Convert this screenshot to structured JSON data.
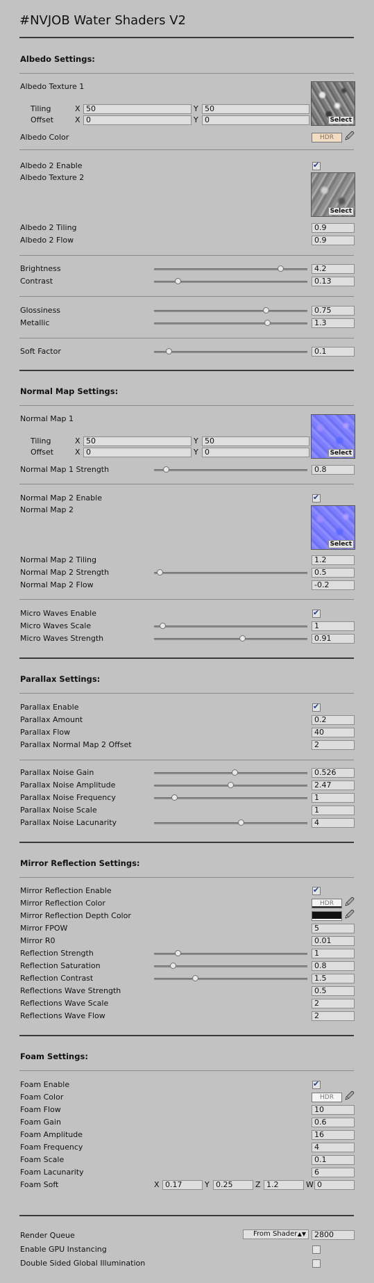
{
  "title": "#NVJOB Water Shaders V2",
  "tex_select": "Select",
  "hdr": "HDR",
  "albedo": {
    "header": "Albedo Settings:",
    "texture1": "Albedo Texture 1",
    "tiling": "Tiling",
    "offset": "Offset",
    "x": "X",
    "y": "Y",
    "tiling_x": "50",
    "tiling_y": "50",
    "offset_x": "0",
    "offset_y": "0",
    "color": "Albedo Color",
    "enable2": "Albedo 2 Enable",
    "texture2": "Albedo Texture 2",
    "tiling2": "Albedo 2 Tiling",
    "tiling2_val": "0.9",
    "flow2": "Albedo 2 Flow",
    "flow2_val": "0.9",
    "brightness": "Brightness",
    "brightness_val": "4.2",
    "contrast": "Contrast",
    "contrast_val": "0.13",
    "glossiness": "Glossiness",
    "glossiness_val": "0.75",
    "metallic": "Metallic",
    "metallic_val": "1.3",
    "soft": "Soft Factor",
    "soft_val": "0.1"
  },
  "normal": {
    "header": "Normal Map Settings:",
    "map1": "Normal Map 1",
    "tiling": "Tiling",
    "offset": "Offset",
    "x": "X",
    "y": "Y",
    "tiling_x": "50",
    "tiling_y": "50",
    "offset_x": "0",
    "offset_y": "0",
    "strength1": "Normal Map 1 Strength",
    "strength1_val": "0.8",
    "enable2": "Normal Map 2 Enable",
    "map2": "Normal Map 2",
    "tiling2": "Normal Map 2 Tiling",
    "tiling2_val": "1.2",
    "strength2": "Normal Map 2 Strength",
    "strength2_val": "0.5",
    "flow2": "Normal Map 2 Flow",
    "flow2_val": "-0.2",
    "micro_enable": "Micro Waves Enable",
    "micro_scale": "Micro Waves Scale",
    "micro_scale_val": "1",
    "micro_strength": "Micro Waves Strength",
    "micro_strength_val": "0.91"
  },
  "parallax": {
    "header": "Parallax Settings:",
    "enable": "Parallax Enable",
    "amount": "Parallax Amount",
    "amount_val": "0.2",
    "flow": "Parallax Flow",
    "flow_val": "40",
    "nm2off": "Parallax Normal Map 2 Offset",
    "nm2off_val": "2",
    "gain": "Parallax Noise Gain",
    "gain_val": "0.526",
    "amplitude": "Parallax Noise Amplitude",
    "amplitude_val": "2.47",
    "frequency": "Parallax Noise Frequency",
    "frequency_val": "1",
    "scale": "Parallax Noise Scale",
    "scale_val": "1",
    "lacunarity": "Parallax Noise Lacunarity",
    "lacunarity_val": "4"
  },
  "mirror": {
    "header": "Mirror Reflection Settings:",
    "enable": "Mirror Reflection Enable",
    "color": "Mirror Reflection Color",
    "depth_color": "Mirror Reflection Depth Color",
    "fpow": "Mirror FPOW",
    "fpow_val": "5",
    "r0": "Mirror R0",
    "r0_val": "0.01",
    "strength": "Reflection Strength",
    "strength_val": "1",
    "saturation": "Reflection Saturation",
    "saturation_val": "0.8",
    "contrast": "Reflection Contrast",
    "contrast_val": "1.5",
    "wave_strength": "Reflections Wave Strength",
    "wave_strength_val": "0.5",
    "wave_scale": "Reflections Wave Scale",
    "wave_scale_val": "2",
    "wave_flow": "Reflections Wave Flow",
    "wave_flow_val": "2"
  },
  "foam": {
    "header": "Foam Settings:",
    "enable": "Foam Enable",
    "color": "Foam Color",
    "flow": "Foam Flow",
    "flow_val": "10",
    "gain": "Foam Gain",
    "gain_val": "0.6",
    "amplitude": "Foam Amplitude",
    "amplitude_val": "16",
    "frequency": "Foam Frequency",
    "frequency_val": "4",
    "scale": "Foam Scale",
    "scale_val": "0.1",
    "lacunarity": "Foam Lacunarity",
    "lacunarity_val": "6",
    "soft": "Foam Soft",
    "soft_x": "0.17",
    "soft_y": "0.25",
    "soft_z": "1.2",
    "soft_w": "0",
    "x": "X",
    "y": "Y",
    "z": "Z",
    "w": "W"
  },
  "render": {
    "queue": "Render Queue",
    "queue_option": "From Shader",
    "queue_val": "2800",
    "gpu": "Enable GPU Instancing",
    "double_gi": "Double Sided Global Illumination"
  },
  "sliders": {
    "brightness": 0.84,
    "contrast": 0.14,
    "glossiness": 0.74,
    "metallic": 0.75,
    "soft": 0.08,
    "normal1": 0.06,
    "normal2": 0.02,
    "micro_scale": 0.04,
    "micro_strength": 0.58,
    "p_gain": 0.53,
    "p_amp": 0.5,
    "p_freq": 0.12,
    "p_lac": 0.57,
    "r_strength": 0.14,
    "r_saturation": 0.11,
    "r_contrast": 0.26
  },
  "checkboxes": {
    "albedo2": true,
    "normal2": true,
    "micro": true,
    "parallax": true,
    "mirror": true,
    "foam": true,
    "gpu": false,
    "double_gi": false
  },
  "icons": {
    "picker": "eyedropper-icon"
  },
  "colors": {
    "background": "#c2c2c2",
    "hdr_peach": "#f0ddc4"
  }
}
